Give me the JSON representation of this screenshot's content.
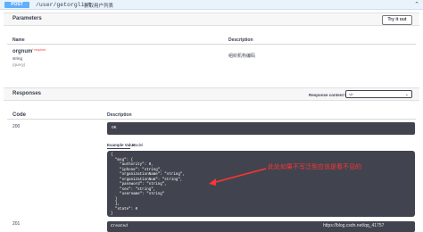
{
  "operation": {
    "method": "POST",
    "path": "/user/getorglist",
    "description": "获取用户列表",
    "collapse_icon": "chevron-up"
  },
  "parameters": {
    "title": "Parameters",
    "try_button": "Try it out",
    "col_name": "Name",
    "col_description": "Description",
    "items": [
      {
        "name": "orgnum",
        "required": "* required",
        "type": "string",
        "in": "(query)",
        "description": "组织机构编码"
      }
    ]
  },
  "responses": {
    "title": "Responses",
    "content_type_label": "Response content type",
    "content_type_value": "*/*",
    "col_code": "Code",
    "col_description": "Description",
    "rows": [
      {
        "code": "200",
        "ok_text": "OK"
      },
      {
        "code": "201",
        "created_text": "Created"
      }
    ],
    "tab_example": "Example Value",
    "tab_model": "Model",
    "example_lines": [
      "{",
      "  \"msg\": {",
      "    \"authority\": 0,",
      "    \"iphone\": \"string\",",
      "    \"organizationName\": \"string\",",
      "    \"organizationNum\": \"string\",",
      "    \"password\": \"string\",",
      "    \"sex\": \"string\",",
      "    \"username\": \"string\"",
      "  }",
      "  ],",
      "  \"state\": 0",
      "}"
    ]
  },
  "annotation": "此处如果不写泛型应该是看不见的",
  "watermark": "https://blog.csdn.net/qq_41757"
}
